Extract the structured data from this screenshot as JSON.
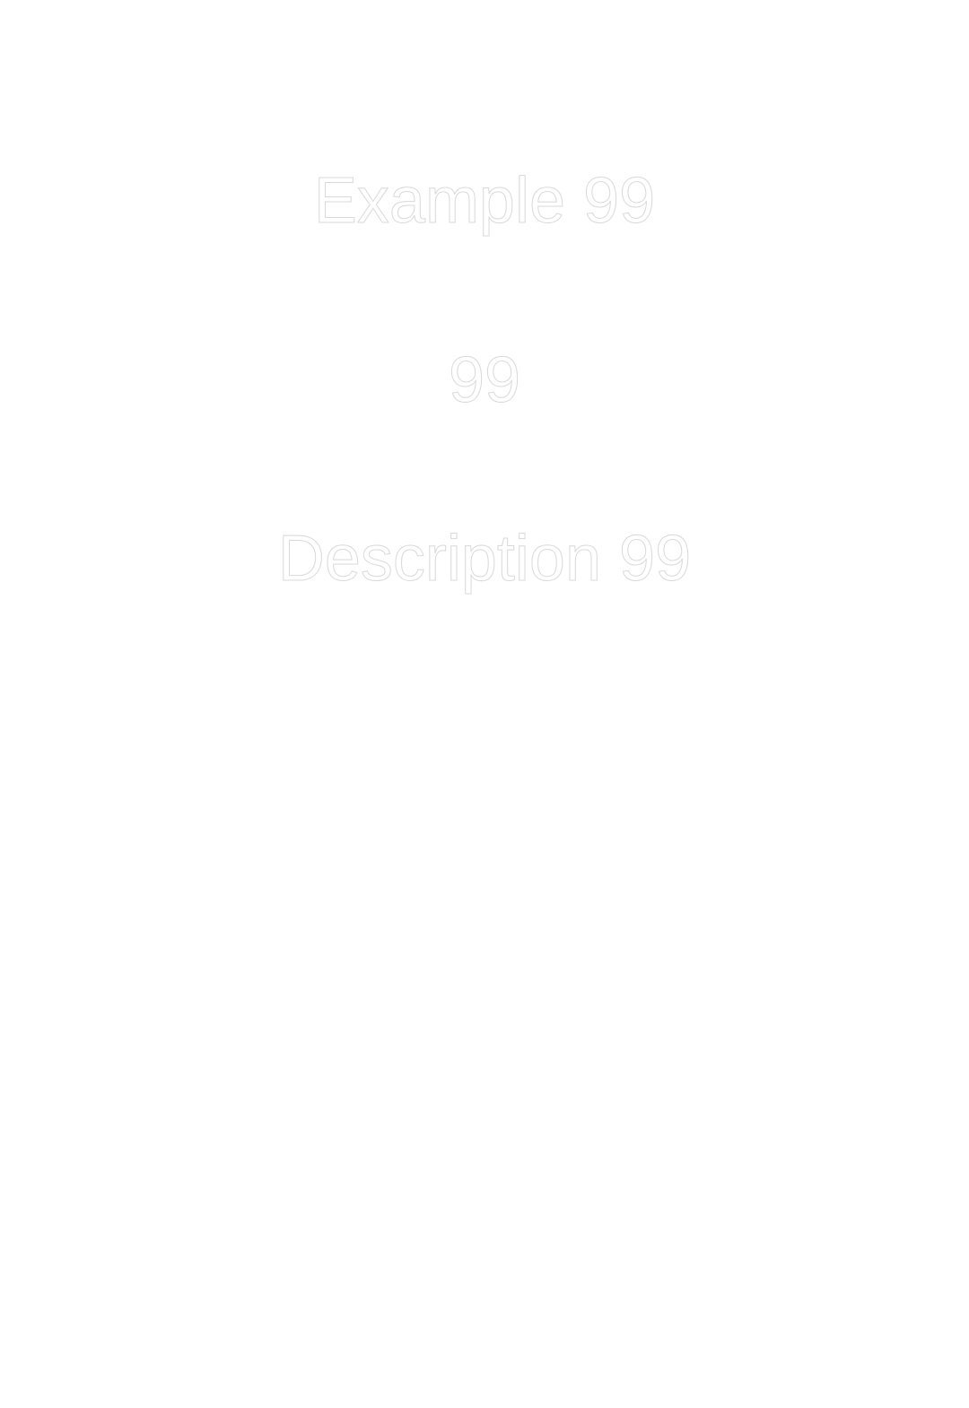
{
  "document": {
    "title": "Example 99",
    "number": "99",
    "description": "Description 99"
  },
  "colors": {
    "background": "#ffffff",
    "text_fill": "#ffffff",
    "text_outline": "#d9d9d9"
  }
}
